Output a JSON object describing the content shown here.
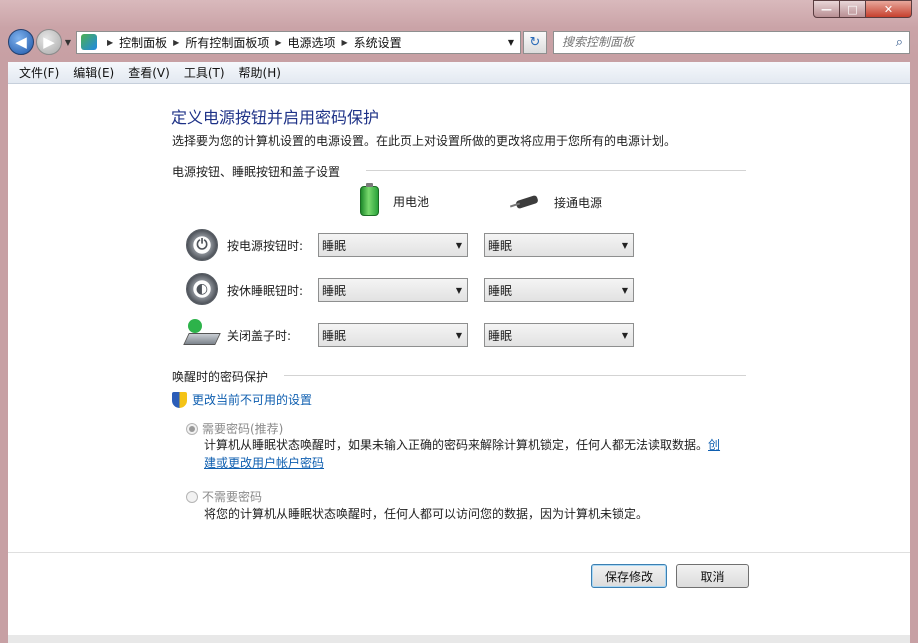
{
  "window": {
    "caption": {
      "minimize": "—",
      "maximize": "□",
      "close": "✕"
    }
  },
  "nav": {
    "back_icon": "back-arrow-icon",
    "forward_icon": "forward-arrow-icon",
    "breadcrumbs": [
      "控制面板",
      "所有控制面板项",
      "电源选项",
      "系统设置"
    ],
    "search_placeholder": "搜索控制面板"
  },
  "menu": [
    "文件(F)",
    "编辑(E)",
    "查看(V)",
    "工具(T)",
    "帮助(H)"
  ],
  "page": {
    "title": "定义电源按钮并启用密码保护",
    "description": "选择要为您的计算机设置的电源设置。在此页上对设置所做的更改将应用于您所有的电源计划。",
    "section1": "电源按钮、睡眠按钮和盖子设置",
    "col_battery": "用电池",
    "col_plugged": "接通电源",
    "rows": [
      {
        "label": "按电源按钮时:",
        "battery": "睡眠",
        "plugged": "睡眠"
      },
      {
        "label": "按休睡眠钮时:",
        "battery": "睡眠",
        "plugged": "睡眠"
      },
      {
        "label": "关闭盖子时:",
        "battery": "睡眠",
        "plugged": "睡眠"
      }
    ],
    "section2": "唤醒时的密码保护",
    "change_link": "更改当前不可用的设置",
    "option_require": "需要密码(推荐)",
    "option_require_desc": "计算机从睡眠状态唤醒时，如果未输入正确的密码来解除计算机锁定，任何人都无法读取数据。",
    "option_require_link": "创建或更改用户帐户密码",
    "option_none": "不需要密码",
    "option_none_desc": "将您的计算机从睡眠状态唤醒时，任何人都可以访问您的数据，因为计算机未锁定。",
    "save_button": "保存修改",
    "cancel_button": "取消"
  },
  "colors": {
    "title": "#1e3287",
    "link": "#0f5fb0"
  }
}
